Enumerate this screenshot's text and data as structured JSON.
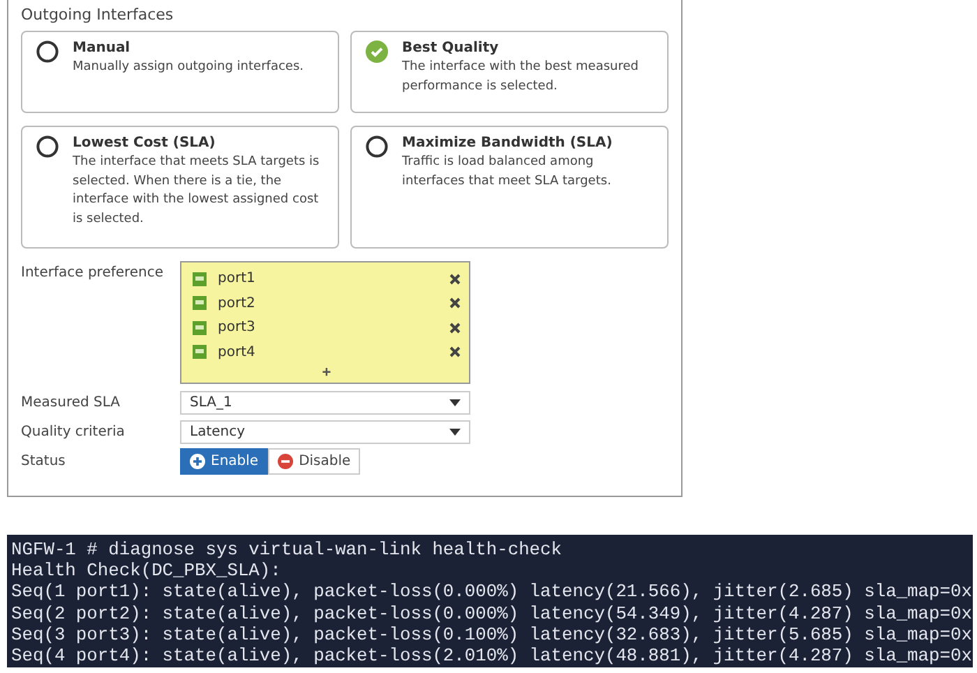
{
  "panel": {
    "title": "Outgoing Interfaces",
    "options": [
      {
        "title": "Manual",
        "description": "Manually assign outgoing interfaces.",
        "selected": false
      },
      {
        "title": "Best Quality",
        "description": "The interface with the best measured performance is selected.",
        "selected": true
      },
      {
        "title": "Lowest Cost (SLA)",
        "description": "The interface that meets SLA targets is selected. When there is a tie, the interface with the lowest assigned cost is selected.",
        "selected": false
      },
      {
        "title": "Maximize Bandwidth (SLA)",
        "description": "Traffic is load balanced among interfaces that meet SLA targets.",
        "selected": false
      }
    ],
    "interface_preference": {
      "label": "Interface preference",
      "items": [
        "port1",
        "port2",
        "port3",
        "port4"
      ],
      "add": "+"
    },
    "measured_sla": {
      "label": "Measured SLA",
      "value": "SLA_1"
    },
    "quality_criteria": {
      "label": "Quality criteria",
      "value": "Latency"
    },
    "status": {
      "label": "Status",
      "options": [
        {
          "label": "Enable",
          "kind": "enable",
          "selected": true
        },
        {
          "label": "Disable",
          "kind": "disable",
          "selected": false
        }
      ]
    }
  },
  "terminal": {
    "lines": [
      "NGFW-1 # diagnose sys virtual-wan-link health-check",
      "Health Check(DC_PBX_SLA):",
      "Seq(1 port1): state(alive), packet-loss(0.000%) latency(21.566), jitter(2.685) sla_map=0x",
      "Seq(2 port2): state(alive), packet-loss(0.000%) latency(54.349), jitter(4.287) sla_map=0x",
      "Seq(3 port3): state(alive), packet-loss(0.100%) latency(32.683), jitter(5.685) sla_map=0x",
      "Seq(4 port4): state(alive), packet-loss(2.010%) latency(48.881), jitter(4.287) sla_map=0x"
    ]
  }
}
